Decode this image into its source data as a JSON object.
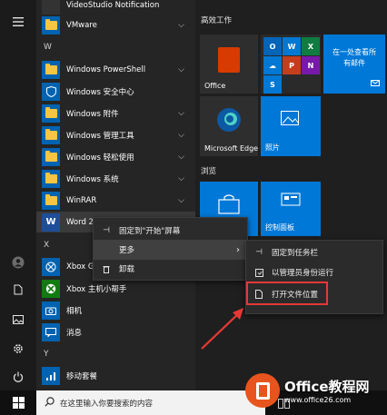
{
  "top_partial_label": "VideoStudio Notification",
  "apps": {
    "section_w": "W",
    "vmware": "VMware",
    "powershell": "Windows PowerShell",
    "security": "Windows 安全中心",
    "accessories": "Windows 附件",
    "admin_tools": "Windows 管理工具",
    "ease": "Windows 轻松使用",
    "system": "Windows 系统",
    "winrar": "WinRAR",
    "word": "Word 2",
    "section_x": "X",
    "xbox_game": "Xbox G",
    "xbox_companion": "Xbox 主机小帮手",
    "camera": "相机",
    "messages": "消息",
    "section_y": "Y",
    "mobile": "移动套餐"
  },
  "tiles": {
    "group_productivity": "高效工作",
    "office": "Office",
    "one_place_line1": "在一处查看所",
    "one_place_line2": "有邮件",
    "edge": "Microsoft Edge",
    "photos": "照片",
    "group_browse": "浏览",
    "control_panel": "控制面板"
  },
  "context_menu": {
    "pin_start": "固定到\"开始\"屏幕",
    "more": "更多",
    "uninstall": "卸载"
  },
  "submenu": {
    "pin_taskbar": "固定到任务栏",
    "run_admin": "以管理员身份运行",
    "open_location": "打开文件位置"
  },
  "taskbar": {
    "search_placeholder": "在这里输入你要搜索的内容"
  },
  "watermark": {
    "title": "Office教程网",
    "url": "www.office26.com"
  },
  "colors": {
    "tile_blue": "#0078d7",
    "folder_blue": "#0063b1",
    "highlight_red": "#e53935",
    "office_red": "#d83b01"
  }
}
